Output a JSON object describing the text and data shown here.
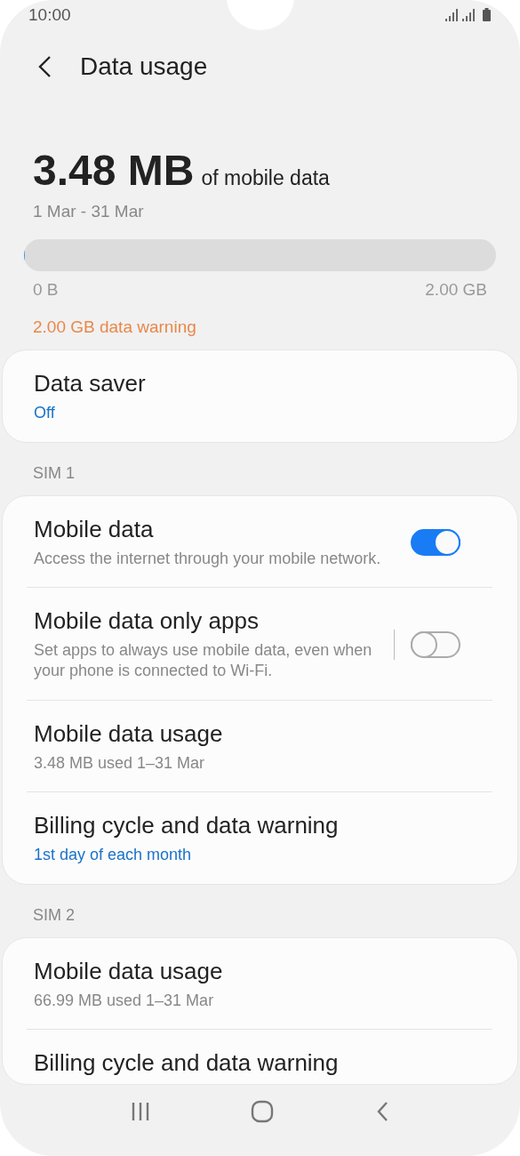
{
  "status_bar": {
    "time": "10:00"
  },
  "header": {
    "title": "Data usage"
  },
  "usage": {
    "amount": "3.48 MB",
    "amount_suffix": "of mobile data",
    "period": "1 Mar - 31 Mar",
    "level": 0.0017,
    "min_label": "0 B",
    "max_label": "2.00 GB",
    "warning": "2.00 GB data warning"
  },
  "sections": [
    {
      "items": [
        {
          "kind": "plain",
          "title": "Data saver",
          "subtitle": "Off",
          "accent": true
        }
      ]
    },
    {
      "label": "SIM 1",
      "items": [
        {
          "kind": "switch",
          "title": "Mobile data",
          "subtitle": "Access the internet through your mobile network.",
          "accent": false,
          "on": true
        },
        {
          "kind": "switch",
          "title": "Mobile data only apps",
          "subtitle": "Set apps to always use mobile data, even when your phone is connected to Wi-Fi.",
          "accent": false,
          "on": false,
          "divider": true
        },
        {
          "kind": "plain",
          "title": "Mobile data usage",
          "subtitle": "3.48 MB used 1–31 Mar",
          "accent": false
        },
        {
          "kind": "plain",
          "title": "Billing cycle and data warning",
          "subtitle": "1st day of each month",
          "accent": true
        }
      ]
    },
    {
      "label": "SIM 2",
      "items": [
        {
          "kind": "plain",
          "title": "Mobile data usage",
          "subtitle": "66.99 MB used 1–31 Mar",
          "accent": false
        },
        {
          "kind": "plain",
          "title": "Billing cycle and data warning"
        }
      ]
    }
  ]
}
